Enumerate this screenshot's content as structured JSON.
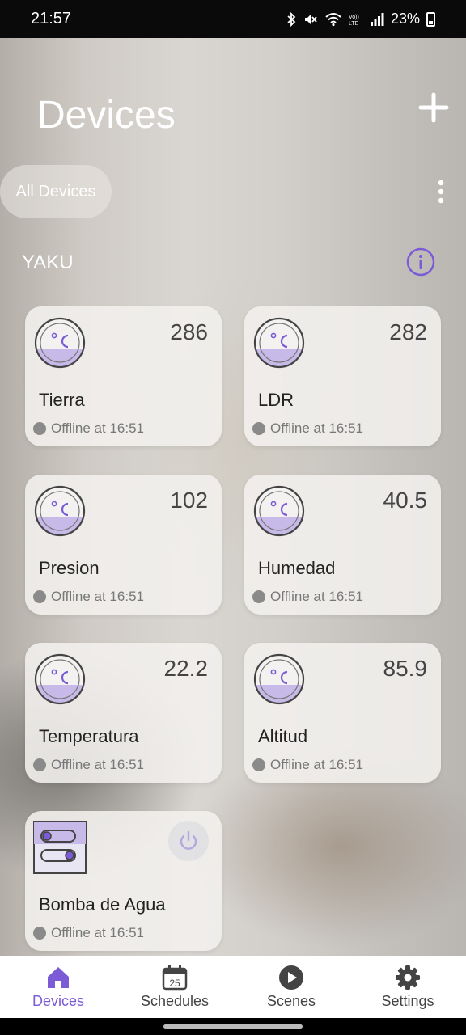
{
  "status_bar": {
    "time": "21:57",
    "battery": "23%",
    "icons": [
      "bluetooth-icon",
      "mute-icon",
      "wifi-icon",
      "volte-icon",
      "signal-icon",
      "battery-icon"
    ]
  },
  "header": {
    "title": "Devices",
    "add_icon": "plus-icon"
  },
  "filter": {
    "chip_label": "All Devices",
    "more_icon": "more-vertical-icon"
  },
  "room": {
    "name": "YAKU",
    "info_icon": "info-icon"
  },
  "devices": [
    {
      "name": "Tierra",
      "value": "286",
      "status": "Offline at 16:51",
      "icon": "thermometer-icon"
    },
    {
      "name": "LDR",
      "value": "282",
      "status": "Offline at 16:51",
      "icon": "thermometer-icon"
    },
    {
      "name": "Presion",
      "value": "102",
      "status": "Offline at 16:51",
      "icon": "thermometer-icon"
    },
    {
      "name": "Humedad",
      "value": "40.5",
      "status": "Offline at 16:51",
      "icon": "thermometer-icon"
    },
    {
      "name": "Temperatura",
      "value": "22.2",
      "status": "Offline at 16:51",
      "icon": "thermometer-icon"
    },
    {
      "name": "Altitud",
      "value": "85.9",
      "status": "Offline at 16:51",
      "icon": "thermometer-icon"
    },
    {
      "name": "Bomba de Agua",
      "value": "",
      "status": "Offline at 16:51",
      "icon": "switch-icon"
    }
  ],
  "bottom_nav": [
    {
      "label": "Devices",
      "icon": "home-icon",
      "active": true
    },
    {
      "label": "Schedules",
      "icon": "calendar-icon",
      "calendar_day": "25",
      "active": false
    },
    {
      "label": "Scenes",
      "icon": "play-icon",
      "active": false
    },
    {
      "label": "Settings",
      "icon": "gear-icon",
      "active": false
    }
  ],
  "colors": {
    "accent": "#7b5cd6",
    "offline_dot": "#8a8a8a",
    "gauge_fill": "#c7b9e8"
  }
}
